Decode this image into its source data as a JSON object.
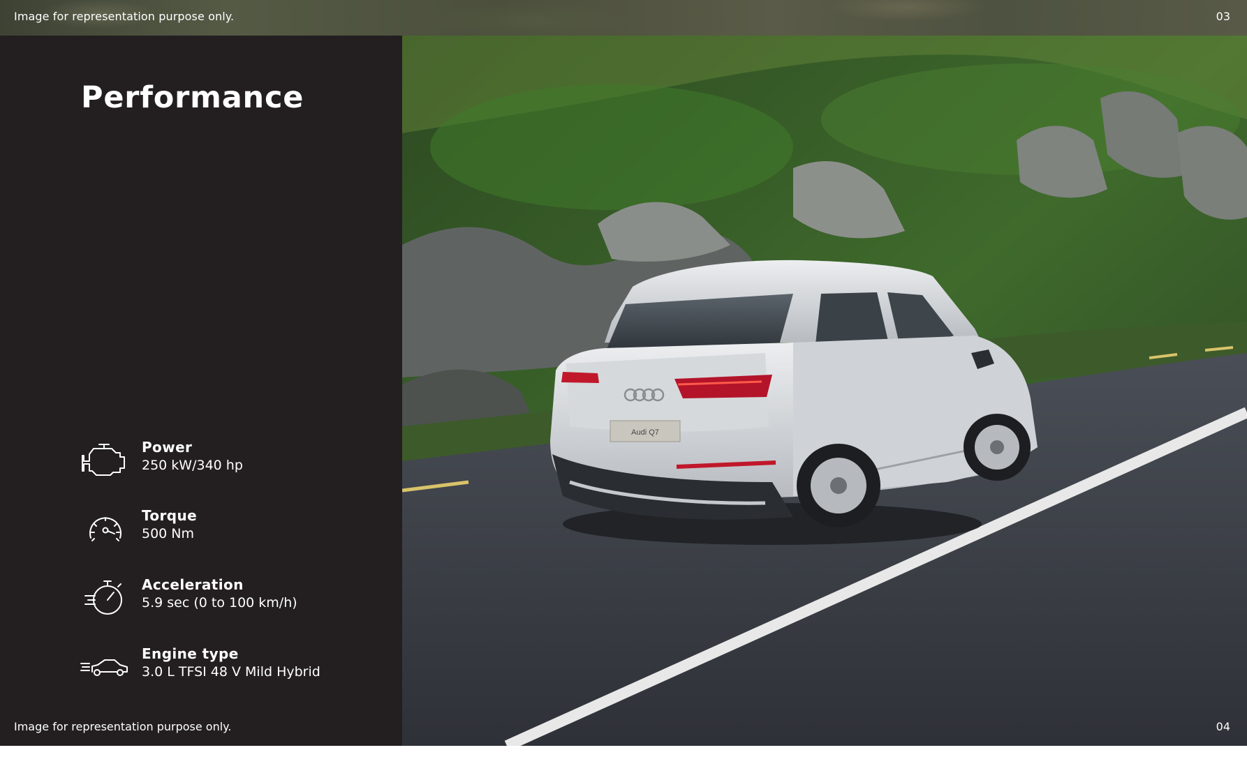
{
  "top": {
    "caption": "Image for representation purpose only.",
    "page_number": "03"
  },
  "section": {
    "title": "Performance"
  },
  "specs": [
    {
      "label": "Power",
      "value": "250 kW/340 hp",
      "icon": "engine-icon"
    },
    {
      "label": "Torque",
      "value": "500 Nm",
      "icon": "gauge-icon"
    },
    {
      "label": "Acceleration",
      "value": "5.9 sec (0 to 100 km/h)",
      "icon": "stopwatch-icon"
    },
    {
      "label": "Engine type",
      "value": "3.0 L TFSI 48 V Mild Hybrid",
      "icon": "car-speed-icon"
    }
  ],
  "photo": {
    "subject": "car-photo",
    "badge_text": "Audi Q7",
    "colors": {
      "road": "#3b3e45",
      "hills": "#2f4a28",
      "car": "#d8dadc",
      "taillight": "#c0182a"
    }
  },
  "bottom": {
    "caption": "Image for representation purpose only.",
    "page_number": "04"
  }
}
